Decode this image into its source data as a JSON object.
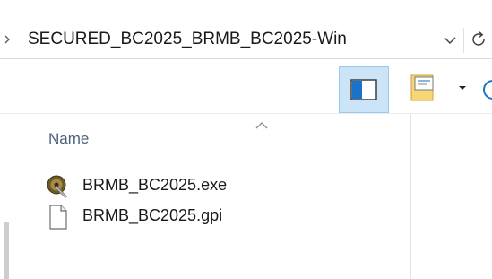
{
  "address_bar": {
    "path": "SECURED_BC2025_BRMB_BC2025-Win"
  },
  "file_list": {
    "column_name": "Name",
    "items": [
      {
        "name": "BRMB_BC2025.exe",
        "icon": "exe-disc-icon"
      },
      {
        "name": "BRMB_BC2025.gpi",
        "icon": "blank-file-icon"
      }
    ]
  },
  "colors": {
    "accent_selected": "#cce4f7",
    "accent_border": "#99c9ef",
    "column_header_text": "#4c607a"
  }
}
